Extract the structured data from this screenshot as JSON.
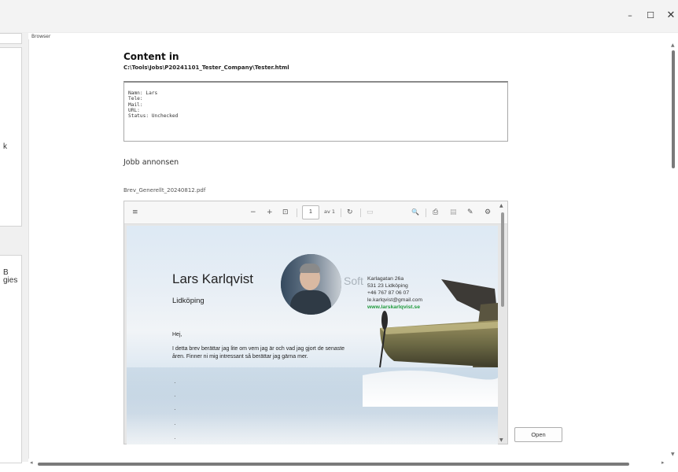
{
  "window": {
    "minimize_label": "–",
    "maximize_label": "☐",
    "close_label": "✕"
  },
  "left_panel": {
    "fragment_1": "k",
    "fragment_2": "B",
    "fragment_3": "gies"
  },
  "browser_label": "Browser",
  "content": {
    "title": "Content in",
    "path": "C:\\Tools\\Jobs\\P20241101_Tester_Company\\Tester.html"
  },
  "info": {
    "lines": [
      "Namn: Lars",
      "Tele:",
      "Mail:",
      "URL:",
      "Status: Unchecked"
    ]
  },
  "job": {
    "heading": "Jobb annonsen",
    "pdf_filename": "Brev_Generellt_20240812.pdf"
  },
  "pdf_toolbar": {
    "menu_icon": "≡",
    "zoom_out": "−",
    "zoom_in": "+",
    "fit_icon": "⊡",
    "page_number": "1",
    "page_of": "av 1",
    "rotate_icon": "↻",
    "two_page_icon": "▭",
    "search_icon": "🔍",
    "print_icon": "⎙",
    "save_icon": "▤",
    "annotate_icon": "✎",
    "settings_icon": "⚙"
  },
  "pdf_page": {
    "name": "Lars Karlqvist",
    "city": "Lidköping",
    "soft_text": "Soft",
    "contact": {
      "street": "Karlagatan 26a",
      "postal": "531 23 Lidköping",
      "phone": "+46 767 87 06 07",
      "email": "le.karlqvist@gmail.com",
      "website": "www.larskarlqvist.se"
    },
    "letter": {
      "greeting": "Hej,",
      "body": "I detta brev berättar jag lite om vem jag är och vad jag gjort de senaste åren. Finner ni mig intressant så berättar jag gärna mer."
    }
  },
  "open_button": "Open",
  "colors": {
    "website_green": "#1f9a3c",
    "scroll_thumb": "#7a7a7a"
  }
}
